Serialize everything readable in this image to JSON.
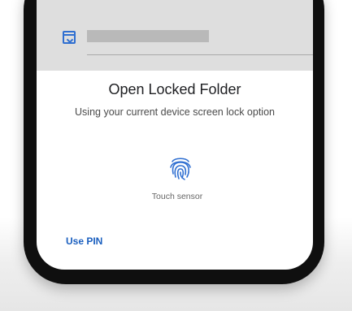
{
  "dialog": {
    "title": "Open Locked Folder",
    "subtitle": "Using your current device screen lock option",
    "sensor_label": "Touch sensor",
    "use_pin_label": "Use PIN"
  },
  "icons": {
    "folder": "locked-folder-icon",
    "fingerprint": "fingerprint-icon"
  },
  "colors": {
    "accent": "#1a5fbf",
    "fingerprint": "#2f6fd1",
    "top_bar": "#dedede",
    "phone_frame": "#0f0f0f"
  }
}
